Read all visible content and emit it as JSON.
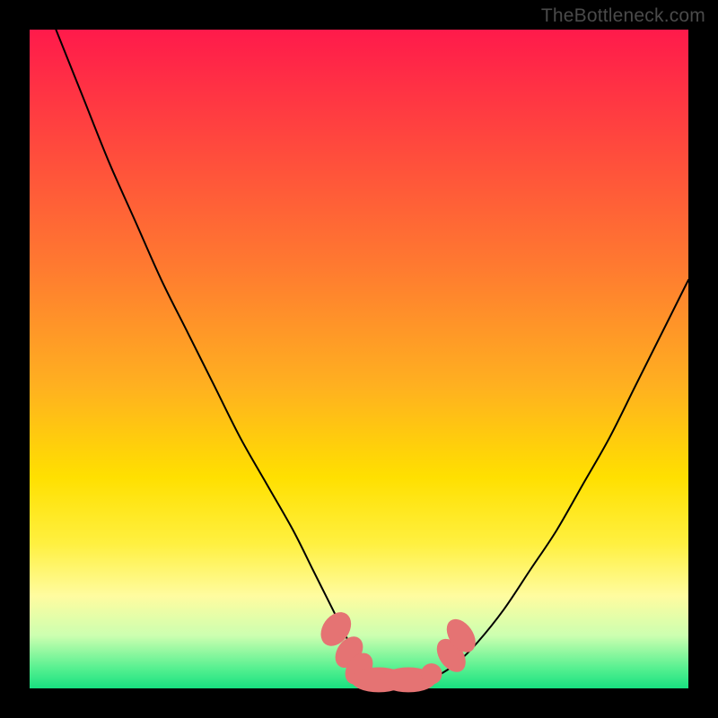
{
  "watermark": "TheBottleneck.com",
  "chart_data": {
    "type": "line",
    "title": "",
    "xlabel": "",
    "ylabel": "",
    "xlim": [
      0,
      100
    ],
    "ylim": [
      0,
      100
    ],
    "series": [
      {
        "name": "bottleneck-curve",
        "x": [
          4,
          8,
          12,
          16,
          20,
          24,
          28,
          32,
          36,
          40,
          43,
          45,
          47,
          49,
          51,
          53,
          55,
          57,
          59,
          62,
          65,
          68,
          72,
          76,
          80,
          84,
          88,
          92,
          96,
          100
        ],
        "values": [
          100,
          90,
          80,
          71,
          62,
          54,
          46,
          38,
          31,
          24,
          18,
          14,
          10,
          6,
          3,
          1.5,
          1,
          1,
          1.2,
          2,
          4,
          7,
          12,
          18,
          24,
          31,
          38,
          46,
          54,
          62
        ]
      }
    ],
    "markers": {
      "name": "highlight-dots",
      "color": "#e57373",
      "points": [
        {
          "x": 46.5,
          "y": 9,
          "rx": 2.0,
          "ry": 2.8,
          "rot": 35
        },
        {
          "x": 48.5,
          "y": 5.5,
          "rx": 1.8,
          "ry": 2.6,
          "rot": 35
        },
        {
          "x": 50.0,
          "y": 3.0,
          "rx": 1.8,
          "ry": 2.6,
          "rot": 35
        },
        {
          "x": 53.0,
          "y": 1.3,
          "rx": 4.2,
          "ry": 1.9,
          "rot": 0
        },
        {
          "x": 57.5,
          "y": 1.3,
          "rx": 4.2,
          "ry": 1.9,
          "rot": 0
        },
        {
          "x": 61.0,
          "y": 2.2,
          "rx": 1.6,
          "ry": 1.6,
          "rot": 0
        },
        {
          "x": 64.0,
          "y": 5.0,
          "rx": 1.8,
          "ry": 2.8,
          "rot": -35
        },
        {
          "x": 65.5,
          "y": 8.0,
          "rx": 1.8,
          "ry": 2.8,
          "rot": -35
        }
      ]
    },
    "gradient_stops": [
      {
        "pos": 0,
        "color": "#ff1a4b"
      },
      {
        "pos": 18,
        "color": "#ff4a3d"
      },
      {
        "pos": 36,
        "color": "#ff7a30"
      },
      {
        "pos": 54,
        "color": "#ffb020"
      },
      {
        "pos": 68,
        "color": "#ffe000"
      },
      {
        "pos": 78,
        "color": "#fff040"
      },
      {
        "pos": 86,
        "color": "#fffca0"
      },
      {
        "pos": 92,
        "color": "#ccffb0"
      },
      {
        "pos": 97,
        "color": "#55f090"
      },
      {
        "pos": 100,
        "color": "#18e080"
      }
    ]
  }
}
